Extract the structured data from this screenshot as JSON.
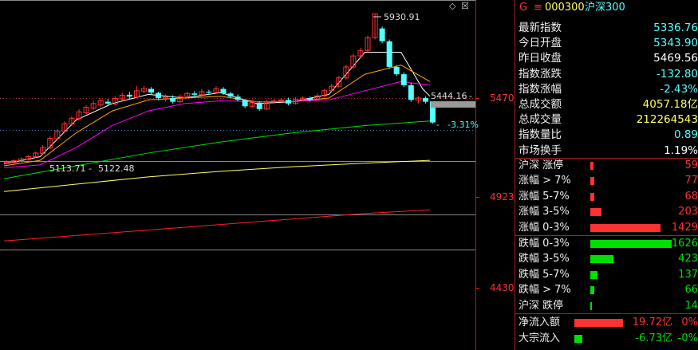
{
  "colors": {
    "up": "#ff3232",
    "down": "#54ffff",
    "bg": "#000000",
    "ma5": "#ffffff",
    "ma10": "#ffa800",
    "ma20": "#ff00ff",
    "ma60": "#00e000",
    "ma120": "#ffff66",
    "ma250": "#ff2020",
    "grid": "#888888",
    "price_label": "#ff3232",
    "cyan": "#54ffff",
    "green_bar": "#00e000"
  },
  "header": {
    "flag": "G",
    "menu_icon": "≡",
    "code": "000300",
    "name": "沪深300"
  },
  "window_icons": {
    "diamond": "◇",
    "close": "☒"
  },
  "chart_labels": {
    "high": "5930.91",
    "last": "5444.16",
    "low_left": "5113.71",
    "low_right": "5122.48",
    "pct": "-3.31%",
    "dash": "-"
  },
  "y_axis": [
    "5470",
    "4923",
    "4430"
  ],
  "quote": [
    {
      "label": "最新指数",
      "value": "5336.76",
      "color": "#54ffff"
    },
    {
      "label": "今日开盘",
      "value": "5343.90",
      "color": "#54ffff"
    },
    {
      "label": "昨日收盘",
      "value": "5469.56",
      "color": "#ffffff"
    },
    {
      "label": "指数涨跌",
      "value": "-132.80",
      "color": "#54ffff"
    },
    {
      "label": "指数涨幅",
      "value": "-2.43%",
      "color": "#54ffff"
    },
    {
      "label": "总成交额",
      "value": "4057.18亿",
      "color": "#ffff66"
    },
    {
      "label": "总成交量",
      "value": "212264543",
      "color": "#ffff66"
    },
    {
      "label": "指数量比",
      "value": "0.89",
      "color": "#54ffff"
    },
    {
      "label": "市场换手",
      "value": "1.19%",
      "color": "#ffffff"
    }
  ],
  "breadth_up": [
    {
      "label": "沪深 涨停",
      "count": "59",
      "level": 0.012
    },
    {
      "label": "涨幅 > 7%",
      "count": "77",
      "level": 0.016
    },
    {
      "label": "涨幅 5-7%",
      "count": "68",
      "level": 0.014
    },
    {
      "label": "涨幅 3-5%",
      "count": "203",
      "level": 0.042
    },
    {
      "label": "涨幅 0-3%",
      "count": "1429",
      "level": 0.26
    }
  ],
  "breadth_down": [
    {
      "label": "跌幅 0-3%",
      "count": "1626",
      "level": 0.3
    },
    {
      "label": "跌幅 3-5%",
      "count": "423",
      "level": 0.085
    },
    {
      "label": "跌幅 5-7%",
      "count": "137",
      "level": 0.026
    },
    {
      "label": "跌幅 > 7%",
      "count": "66",
      "level": 0.016
    },
    {
      "label": "沪深 跌停",
      "count": "14",
      "level": 0.005
    }
  ],
  "flows": [
    {
      "label": "净流入额",
      "value": "19.72亿",
      "pct": "0%",
      "dir": "up",
      "level": 0.18
    },
    {
      "label": "大宗流入",
      "value": "-6.73亿",
      "pct": "-0%",
      "dir": "down",
      "level": 0.028
    }
  ],
  "chart_data": {
    "type": "candlestick",
    "y_axis_ticks": [
      5470,
      4923,
      4430
    ],
    "ylim": [
      4280,
      5990
    ],
    "high_label": 5930.91,
    "low_labels": [
      5113.71,
      5122.48
    ],
    "last_label": 5444.16,
    "change_pct_label": "-3.31%",
    "candles": [
      [
        5113,
        5120,
        5108,
        5130
      ],
      [
        5118,
        5128,
        5112,
        5135
      ],
      [
        5125,
        5138,
        5120,
        5145
      ],
      [
        5135,
        5150,
        5128,
        5158
      ],
      [
        5150,
        5170,
        5142,
        5178
      ],
      [
        5168,
        5200,
        5160,
        5212
      ],
      [
        5198,
        5250,
        5190,
        5262
      ],
      [
        5248,
        5290,
        5240,
        5300
      ],
      [
        5288,
        5330,
        5280,
        5342
      ],
      [
        5328,
        5360,
        5318,
        5372
      ],
      [
        5358,
        5395,
        5350,
        5410
      ],
      [
        5390,
        5420,
        5380,
        5432
      ],
      [
        5415,
        5440,
        5405,
        5455
      ],
      [
        5432,
        5455,
        5420,
        5470
      ],
      [
        5450,
        5440,
        5425,
        5465
      ],
      [
        5438,
        5468,
        5430,
        5480
      ],
      [
        5465,
        5485,
        5455,
        5500
      ],
      [
        5488,
        5478,
        5460,
        5505
      ],
      [
        5475,
        5510,
        5468,
        5535
      ],
      [
        5508,
        5522,
        5495,
        5535
      ],
      [
        5520,
        5500,
        5488,
        5530
      ],
      [
        5498,
        5470,
        5458,
        5505
      ],
      [
        5468,
        5475,
        5450,
        5490
      ],
      [
        5470,
        5450,
        5440,
        5485
      ],
      [
        5450,
        5478,
        5442,
        5490
      ],
      [
        5478,
        5495,
        5470,
        5505
      ],
      [
        5495,
        5488,
        5478,
        5508
      ],
      [
        5488,
        5505,
        5480,
        5520
      ],
      [
        5505,
        5500,
        5490,
        5515
      ],
      [
        5500,
        5520,
        5492,
        5535
      ],
      [
        5520,
        5495,
        5488,
        5530
      ],
      [
        5495,
        5478,
        5470,
        5505
      ],
      [
        5478,
        5460,
        5452,
        5490
      ],
      [
        5460,
        5425,
        5415,
        5465
      ],
      [
        5425,
        5445,
        5418,
        5458
      ],
      [
        5445,
        5410,
        5400,
        5452
      ],
      [
        5410,
        5450,
        5405,
        5462
      ],
      [
        5450,
        5455,
        5440,
        5465
      ],
      [
        5455,
        5460,
        5448,
        5470
      ],
      [
        5460,
        5440,
        5430,
        5472
      ],
      [
        5440,
        5462,
        5435,
        5475
      ],
      [
        5462,
        5470,
        5452,
        5480
      ],
      [
        5470,
        5460,
        5450,
        5478
      ],
      [
        5460,
        5482,
        5455,
        5495
      ],
      [
        5482,
        5510,
        5475,
        5520
      ],
      [
        5510,
        5535,
        5500,
        5548
      ],
      [
        5535,
        5580,
        5525,
        5590
      ],
      [
        5580,
        5640,
        5570,
        5652
      ],
      [
        5640,
        5700,
        5630,
        5712
      ],
      [
        5700,
        5730,
        5690,
        5745
      ],
      [
        5730,
        5800,
        5720,
        5810
      ],
      [
        5800,
        5930,
        5790,
        5930.91
      ],
      [
        5850,
        5780,
        5770,
        5860
      ],
      [
        5780,
        5640,
        5630,
        5790
      ],
      [
        5640,
        5600,
        5590,
        5650
      ],
      [
        5600,
        5540,
        5530,
        5610
      ],
      [
        5540,
        5460,
        5450,
        5552
      ],
      [
        5460,
        5470,
        5440,
        5480
      ],
      [
        5470,
        5450,
        5440,
        5480
      ],
      [
        5452,
        5336.76,
        5330,
        5444.16
      ]
    ],
    "moving_averages": [
      {
        "name": "MA5",
        "color": "#ffffff",
        "points": [
          [
            0,
            5110
          ],
          [
            5,
            5150
          ],
          [
            10,
            5350
          ],
          [
            15,
            5440
          ],
          [
            20,
            5490
          ],
          [
            25,
            5470
          ],
          [
            30,
            5500
          ],
          [
            35,
            5440
          ],
          [
            40,
            5450
          ],
          [
            45,
            5490
          ],
          [
            50,
            5720
          ],
          [
            55,
            5720
          ],
          [
            58,
            5520
          ],
          [
            59,
            5480
          ]
        ]
      },
      {
        "name": "MA10",
        "color": "#ffa800",
        "points": [
          [
            0,
            5100
          ],
          [
            5,
            5130
          ],
          [
            10,
            5280
          ],
          [
            15,
            5400
          ],
          [
            20,
            5460
          ],
          [
            25,
            5470
          ],
          [
            30,
            5480
          ],
          [
            35,
            5450
          ],
          [
            40,
            5450
          ],
          [
            45,
            5470
          ],
          [
            50,
            5600
          ],
          [
            55,
            5650
          ],
          [
            59,
            5560
          ]
        ]
      },
      {
        "name": "MA20",
        "color": "#ff00ff",
        "points": [
          [
            0,
            5090
          ],
          [
            5,
            5105
          ],
          [
            10,
            5200
          ],
          [
            15,
            5320
          ],
          [
            20,
            5400
          ],
          [
            25,
            5440
          ],
          [
            30,
            5455
          ],
          [
            35,
            5450
          ],
          [
            40,
            5452
          ],
          [
            45,
            5460
          ],
          [
            50,
            5510
          ],
          [
            55,
            5560
          ],
          [
            59,
            5540
          ]
        ]
      },
      {
        "name": "MA60",
        "color": "#00e000",
        "points": [
          [
            0,
            5030
          ],
          [
            10,
            5100
          ],
          [
            20,
            5170
          ],
          [
            30,
            5230
          ],
          [
            40,
            5280
          ],
          [
            50,
            5320
          ],
          [
            59,
            5345
          ]
        ]
      },
      {
        "name": "MA120",
        "color": "#ffff66",
        "points": [
          [
            0,
            4960
          ],
          [
            10,
            5000
          ],
          [
            20,
            5040
          ],
          [
            30,
            5070
          ],
          [
            40,
            5095
          ],
          [
            50,
            5115
          ],
          [
            59,
            5130
          ]
        ]
      },
      {
        "name": "MA250",
        "color": "#ff2020",
        "points": [
          [
            0,
            4690
          ],
          [
            10,
            4720
          ],
          [
            20,
            4750
          ],
          [
            30,
            4780
          ],
          [
            40,
            4810
          ],
          [
            50,
            4840
          ],
          [
            59,
            4860
          ]
        ]
      }
    ]
  }
}
